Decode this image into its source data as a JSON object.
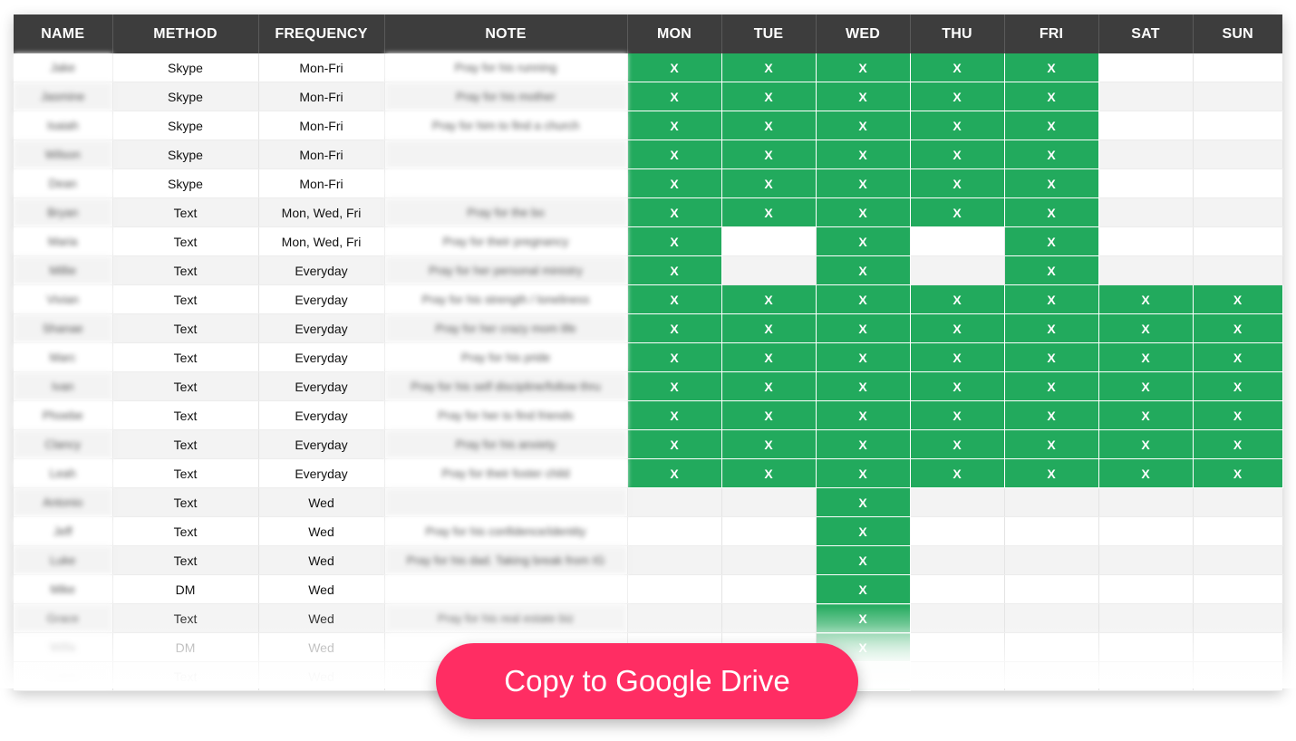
{
  "columns": [
    "NAME",
    "METHOD",
    "FREQUENCY",
    "NOTE",
    "MON",
    "TUE",
    "WED",
    "THU",
    "FRI",
    "SAT",
    "SUN"
  ],
  "mark": "X",
  "rows": [
    {
      "name": "Jake",
      "method": "Skype",
      "frequency": "Mon-Fri",
      "note": "Pray for his running",
      "days": [
        1,
        1,
        1,
        1,
        1,
        0,
        0
      ]
    },
    {
      "name": "Jasmine",
      "method": "Skype",
      "frequency": "Mon-Fri",
      "note": "Pray for his mother",
      "days": [
        1,
        1,
        1,
        1,
        1,
        0,
        0
      ]
    },
    {
      "name": "Isaiah",
      "method": "Skype",
      "frequency": "Mon-Fri",
      "note": "Pray for him to find a church",
      "days": [
        1,
        1,
        1,
        1,
        1,
        0,
        0
      ]
    },
    {
      "name": "Wilson",
      "method": "Skype",
      "frequency": "Mon-Fri",
      "note": "",
      "days": [
        1,
        1,
        1,
        1,
        1,
        0,
        0
      ]
    },
    {
      "name": "Dean",
      "method": "Skype",
      "frequency": "Mon-Fri",
      "note": "",
      "days": [
        1,
        1,
        1,
        1,
        1,
        0,
        0
      ]
    },
    {
      "name": "Bryan",
      "method": "Text",
      "frequency": "Mon, Wed, Fri",
      "note": "Pray for the bo",
      "days": [
        1,
        1,
        1,
        1,
        1,
        0,
        0
      ]
    },
    {
      "name": "Maria",
      "method": "Text",
      "frequency": "Mon, Wed, Fri",
      "note": "Pray for their pregnancy",
      "days": [
        1,
        0,
        1,
        0,
        1,
        0,
        0
      ]
    },
    {
      "name": "Millie",
      "method": "Text",
      "frequency": "Everyday",
      "note": "Pray for her personal ministry",
      "days": [
        1,
        0,
        1,
        0,
        1,
        0,
        0
      ]
    },
    {
      "name": "Vivian",
      "method": "Text",
      "frequency": "Everyday",
      "note": "Pray for his strength / loneliness",
      "days": [
        1,
        1,
        1,
        1,
        1,
        1,
        1
      ]
    },
    {
      "name": "Shanae",
      "method": "Text",
      "frequency": "Everyday",
      "note": "Pray for her crazy mom life",
      "days": [
        1,
        1,
        1,
        1,
        1,
        1,
        1
      ]
    },
    {
      "name": "Marc",
      "method": "Text",
      "frequency": "Everyday",
      "note": "Pray for his pride",
      "days": [
        1,
        1,
        1,
        1,
        1,
        1,
        1
      ]
    },
    {
      "name": "Ivan",
      "method": "Text",
      "frequency": "Everyday",
      "note": "Pray for his self discipline/follow thru",
      "days": [
        1,
        1,
        1,
        1,
        1,
        1,
        1
      ]
    },
    {
      "name": "Phoebe",
      "method": "Text",
      "frequency": "Everyday",
      "note": "Pray for her to find friends",
      "days": [
        1,
        1,
        1,
        1,
        1,
        1,
        1
      ]
    },
    {
      "name": "Clancy",
      "method": "Text",
      "frequency": "Everyday",
      "note": "Pray for his anxiety",
      "days": [
        1,
        1,
        1,
        1,
        1,
        1,
        1
      ]
    },
    {
      "name": "Leah",
      "method": "Text",
      "frequency": "Everyday",
      "note": "Pray for their foster child",
      "days": [
        1,
        1,
        1,
        1,
        1,
        1,
        1
      ]
    },
    {
      "name": "Antonio",
      "method": "Text",
      "frequency": "Wed",
      "note": "",
      "days": [
        0,
        0,
        1,
        0,
        0,
        0,
        0
      ]
    },
    {
      "name": "Jeff",
      "method": "Text",
      "frequency": "Wed",
      "note": "Pray for his confidence/identity",
      "days": [
        0,
        0,
        1,
        0,
        0,
        0,
        0
      ]
    },
    {
      "name": "Luke",
      "method": "Text",
      "frequency": "Wed",
      "note": "Pray for his dad. Taking break from IG",
      "days": [
        0,
        0,
        1,
        0,
        0,
        0,
        0
      ]
    },
    {
      "name": "Mike",
      "method": "DM",
      "frequency": "Wed",
      "note": "",
      "days": [
        0,
        0,
        1,
        0,
        0,
        0,
        0
      ]
    },
    {
      "name": "Grace",
      "method": "Text",
      "frequency": "Wed",
      "note": "Pray for his real estate biz",
      "days": [
        0,
        0,
        1,
        0,
        0,
        0,
        0
      ]
    },
    {
      "name": "Willa",
      "method": "DM",
      "frequency": "Wed",
      "note": "",
      "days": [
        0,
        0,
        1,
        0,
        0,
        0,
        0
      ]
    },
    {
      "name": "Caleb",
      "method": "Text",
      "frequency": "Wed",
      "note": "1",
      "days": [
        0,
        0,
        1,
        0,
        0,
        0,
        0
      ]
    }
  ],
  "cta_label": "Copy to Google Drive"
}
